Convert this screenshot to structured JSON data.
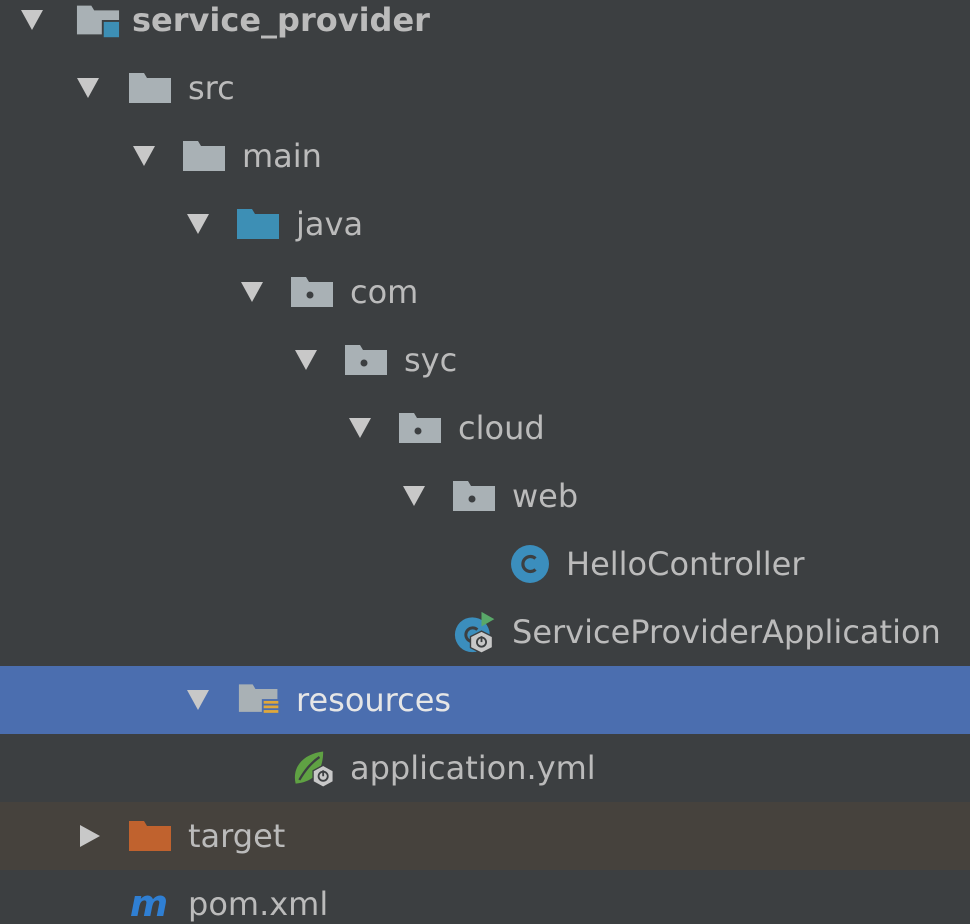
{
  "tree": {
    "root": {
      "label": "service_provider",
      "icon": "module-folder-icon"
    },
    "src": {
      "label": "src",
      "icon": "folder-icon"
    },
    "main": {
      "label": "main",
      "icon": "folder-icon"
    },
    "java": {
      "label": "java",
      "icon": "source-root-folder-icon"
    },
    "com": {
      "label": "com",
      "icon": "package-icon"
    },
    "syc": {
      "label": "syc",
      "icon": "package-icon"
    },
    "cloud": {
      "label": "cloud",
      "icon": "package-icon"
    },
    "web": {
      "label": "web",
      "icon": "package-icon"
    },
    "hello_controller": {
      "label": "HelloController",
      "icon": "java-class-icon"
    },
    "service_provider_application": {
      "label": "ServiceProviderApplication",
      "icon": "spring-boot-run-class-icon"
    },
    "resources": {
      "label": "resources",
      "icon": "resources-root-folder-icon"
    },
    "application_yml": {
      "label": "application.yml",
      "icon": "spring-config-file-icon"
    },
    "target": {
      "label": "target",
      "icon": "excluded-folder-icon"
    },
    "pom": {
      "label": "pom.xml",
      "icon": "maven-file-icon"
    }
  },
  "colors": {
    "background": "#3c3f41",
    "selection": "#4b6eaf",
    "excluded_row": "#46423d",
    "text": "#bbbbbb",
    "folder": "#a9b1b5",
    "source_root": "#3d8fb5",
    "excluded_folder": "#c0622e",
    "class_icon": "#3b8ebd",
    "spring_green": "#5fa143",
    "maven_blue": "#2f7fd3"
  }
}
